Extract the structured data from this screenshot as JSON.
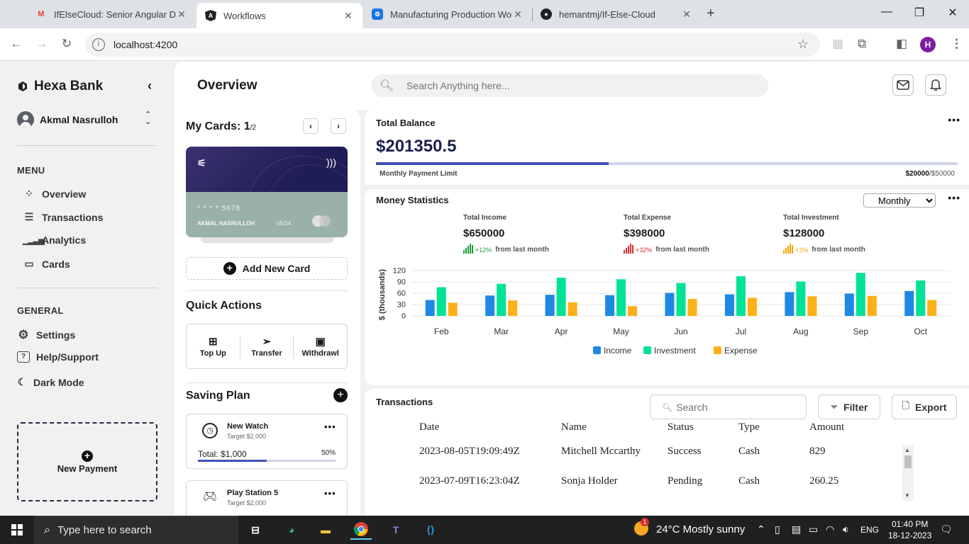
{
  "browser": {
    "tabs": [
      {
        "label": "IfElseCloud: Senior Angular Dev",
        "icon": "gmail-icon",
        "active": false
      },
      {
        "label": "Workflows",
        "icon": "angular-icon",
        "active": true
      },
      {
        "label": "Manufacturing Production Wor",
        "icon": "app-icon",
        "active": false
      },
      {
        "label": "hemantmj/If-Else-Cloud",
        "icon": "github-icon",
        "active": false
      }
    ],
    "url": "localhost:4200",
    "profile_initial": "H"
  },
  "sidebar": {
    "brand": "Hexa Bank",
    "user": "Akmal Nasrulloh",
    "menu_heading": "MENU",
    "menu": [
      {
        "label": "Overview",
        "icon": "overview-icon"
      },
      {
        "label": "Transactions",
        "icon": "list-icon"
      },
      {
        "label": "Analytics",
        "icon": "signal-bars-icon"
      },
      {
        "label": "Cards",
        "icon": "card-icon"
      }
    ],
    "general_heading": "GENERAL",
    "general": [
      {
        "label": "Settings",
        "icon": "gear-icon"
      },
      {
        "label": "Help/Support",
        "icon": "help-icon"
      },
      {
        "label": "Dark Mode",
        "icon": "moon-icon"
      }
    ],
    "new_payment": "New Payment"
  },
  "header": {
    "title": "Overview",
    "search_placeholder": "Search Anything here..."
  },
  "cards": {
    "title": "My Cards: ",
    "current": "1",
    "total": "/2",
    "card_number": "* * * *    5678",
    "holder": "AKMAL NASRULLOH",
    "expiry": "05/24",
    "add_card": "Add New Card"
  },
  "quick_actions": {
    "title": "Quick Actions",
    "items": [
      {
        "label": "Top Up",
        "icon": "plus-square-icon"
      },
      {
        "label": "Transfer",
        "icon": "send-icon"
      },
      {
        "label": "Withdrawl",
        "icon": "cash-icon"
      }
    ]
  },
  "saving_plan": {
    "title": "Saving Plan",
    "plans": [
      {
        "name": "New Watch",
        "target": "Target $2,000",
        "total": "Total: $1,000",
        "percent": "50%",
        "progress": 0.5,
        "icon": "clock-icon"
      },
      {
        "name": "Play Station 5",
        "target": "Target $2,000",
        "icon": "gamepad-icon"
      }
    ]
  },
  "balance": {
    "title": "Total Balance",
    "value": "$201350.5",
    "limit_label": "Monthly Payment Limit",
    "limit_used": "$20000",
    "limit_total": "/$50000",
    "progress": 0.4
  },
  "stats": {
    "title": "Money Statistics",
    "period": "Monthly",
    "period_options": [
      "Monthly"
    ],
    "kpis": [
      {
        "label": "Total Income",
        "value": "$650000",
        "change": "+12%",
        "note": "from last month",
        "color": "#1e9e3a"
      },
      {
        "label": "Total Expense",
        "value": "$398000",
        "change": "+32%",
        "note": "from last month",
        "color": "#d32f2f"
      },
      {
        "label": "Total Investment",
        "value": "$128000",
        "change": "+3%",
        "note": "from last month",
        "color": "#f0a500"
      }
    ]
  },
  "chart_data": {
    "type": "bar",
    "categories": [
      "Feb",
      "Mar",
      "Apr",
      "May",
      "Jun",
      "Jul",
      "Aug",
      "Sep",
      "Oct"
    ],
    "series": [
      {
        "name": "Income",
        "color": "#1e88e5",
        "values": [
          42,
          54,
          56,
          55,
          61,
          57,
          63,
          59,
          66
        ]
      },
      {
        "name": "Investment",
        "color": "#00e396",
        "values": [
          76,
          85,
          101,
          97,
          87,
          105,
          91,
          114,
          94
        ]
      },
      {
        "name": "Expense",
        "color": "#feb019",
        "values": [
          35,
          41,
          36,
          26,
          45,
          48,
          52,
          53,
          42
        ]
      }
    ],
    "ylabel": "$ (thousands)",
    "ylim": [
      0,
      120
    ],
    "yticks": [
      0,
      30,
      60,
      90,
      120
    ],
    "legend": "bottom"
  },
  "transactions": {
    "title": "Transactions",
    "search_placeholder": "Search",
    "filter": "Filter",
    "export": "Export",
    "columns": [
      "Date",
      "Name",
      "Status",
      "Type",
      "Amount"
    ],
    "rows": [
      [
        "2023-08-05T19:09:49Z",
        "Mitchell Mccarthy",
        "Success",
        "Cash",
        "829"
      ],
      [
        "2023-07-09T16:23:04Z",
        "Sonja Holder",
        "Pending",
        "Cash",
        "260.25"
      ]
    ]
  },
  "taskbar": {
    "search_placeholder": "Type here to search",
    "weather": "24°C  Mostly sunny",
    "lang": "ENG",
    "time": "01:40 PM",
    "date": "18-12-2023",
    "notif_badge": "1"
  }
}
